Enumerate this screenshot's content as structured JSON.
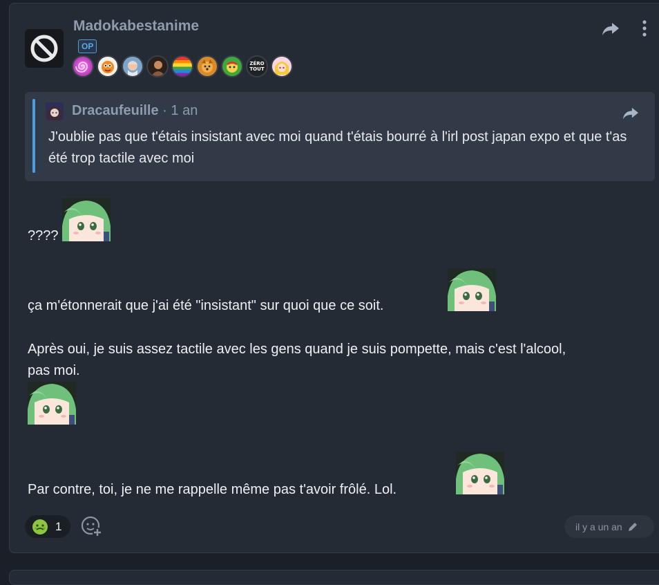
{
  "post": {
    "username": "Madokabestanime",
    "op_badge": "OP",
    "avatar_icon": "ban-icon",
    "badge_icons": [
      "swirl-badge-icon",
      "orange-character-badge-icon",
      "old-man-badge-icon",
      "portrait-badge-icon",
      "rainbow-flag-badge-icon",
      "dog-badge-icon",
      "green-mascot-badge-icon",
      "zero-tout-badge-icon",
      "anime-girl-badge-icon"
    ],
    "zero_tout_label_1": "ZÉRO",
    "zero_tout_label_2": "TOUT"
  },
  "quote": {
    "author": "Dracaufeuille",
    "separator": " · ",
    "time": "1 an",
    "text": "J'oublie pas que t'étais insistant avec moi quand t'étais bourré à l'irl post japan expo et que t'as été trop tactile avec moi"
  },
  "body": {
    "line1": "????",
    "line2": "ça m'étonnerait que j'ai été \"insistant\" sur quoi que ce soit.",
    "line3a": "Après oui, je suis assez tactile avec les gens quand je suis pompette, mais c'est l'alcool,",
    "line3b": "pas moi.",
    "line4": "Par contre, toi, je ne me rappelle même pas t'avoir frôlé. Lol.",
    "sticker_icon": "green-hair-anime-sticker-icon"
  },
  "footer": {
    "reaction_icon": "sick-face-emoji-icon",
    "reaction_count": "1",
    "timestamp": "il y a un an"
  },
  "colors": {
    "background": "#1b1f27",
    "card": "#252b35",
    "quote_bg": "#313a46",
    "accent_blue": "#4a9fe0",
    "muted_text": "#8f9bae"
  }
}
